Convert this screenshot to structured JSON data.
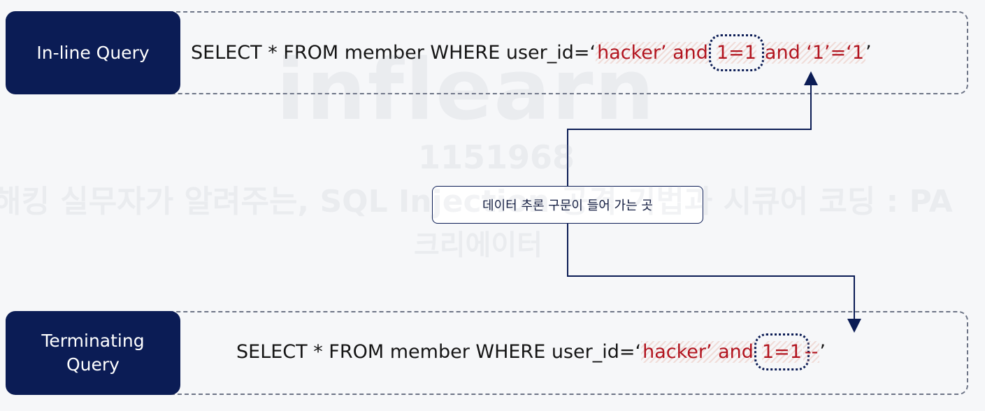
{
  "rows": [
    {
      "label": "In-line Query",
      "query_prefix": "SELECT * FROM member WHERE user_id=‘",
      "query_injected": "hacker’ and",
      "query_focus": "1=1",
      "query_suffix": "and ‘1’=‘1",
      "query_end": "’"
    },
    {
      "label": "Terminating\nQuery",
      "query_prefix": "SELECT * FROM member WHERE user_id=‘",
      "query_injected": "hacker’ and",
      "query_focus": "1=1",
      "query_suffix": "--",
      "query_end": "’"
    }
  ],
  "callout": {
    "text": "데이터 추론 구문이 들어 가는 곳"
  },
  "watermark": {
    "brand": "inflearn",
    "user_id": "1151968",
    "course": "해킹 실무자가 알려주는, SQL Injection 공격 기법과 시큐어 코딩 : PA",
    "author": "크리에이터"
  },
  "colors": {
    "label_bg": "#0b1c55",
    "injected_text": "#b2141f",
    "frame_border": "#6d7486",
    "connector": "#0b1c55"
  }
}
